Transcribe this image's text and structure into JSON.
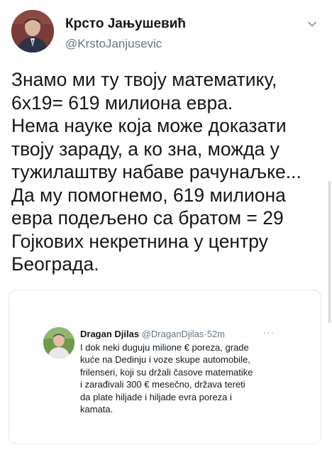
{
  "author": {
    "display_name": "Крсто Јањушевић",
    "handle": "@KrstoJanjusevic"
  },
  "tweet": {
    "text": "Знамо ми ту твоју математику,\n6х19= 619 милиона евра.\nНема науке која може доказати\nтвоју зараду, а ко зна, можда у\nтужилаштву набаве рачунаљке...\nДа му помогнемо, 619 милиона\nевра подељено са братом = 29\nГојкових некретнина у центру\nБеограда."
  },
  "quoted_tweet": {
    "display_name": "Dragan Djilas",
    "handle": "@DraganDjilas",
    "separator": "·",
    "time": "52m",
    "more": "···",
    "text": "I dok neki duguju milione € poreza, grade\nkuće na Dedinju i voze skupe automobile,\nfrilenseri, koji su držali časove matematike\ni zarađivali 300 € mesečno, država tereti\nda plate hiljade i hiljade evra poreza i\nkamata."
  },
  "icons": {
    "caret": "chevron-down-icon",
    "avatar": "profile-photo",
    "quoted_avatar": "profile-photo"
  },
  "colors": {
    "text_primary": "#14171a",
    "text_secondary": "#657786",
    "border": "#e1e8ed"
  }
}
